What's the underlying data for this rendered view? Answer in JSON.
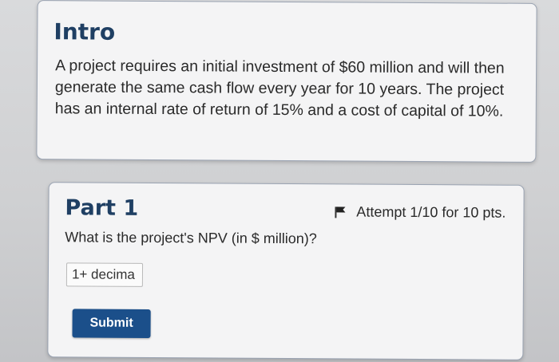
{
  "intro": {
    "title": "Intro",
    "text": "A project requires an initial investment of $60 million and will then generate the same cash flow every year for 10 years. The project has an internal rate of return of 15% and a cost of capital of 10%."
  },
  "part1": {
    "title": "Part 1",
    "attempt": "Attempt 1/10 for 10 pts.",
    "question": "What is the project's NPV (in $ million)?",
    "input_placeholder": "1+ decima",
    "input_value": "",
    "submit_label": "Submit"
  },
  "colors": {
    "heading": "#1f3f63",
    "submit_bg": "#1b4f8a",
    "card_border": "#9aa3b2",
    "card_bg": "#f4f4f5"
  },
  "icons": {
    "attempt_flag": "flag-icon"
  }
}
